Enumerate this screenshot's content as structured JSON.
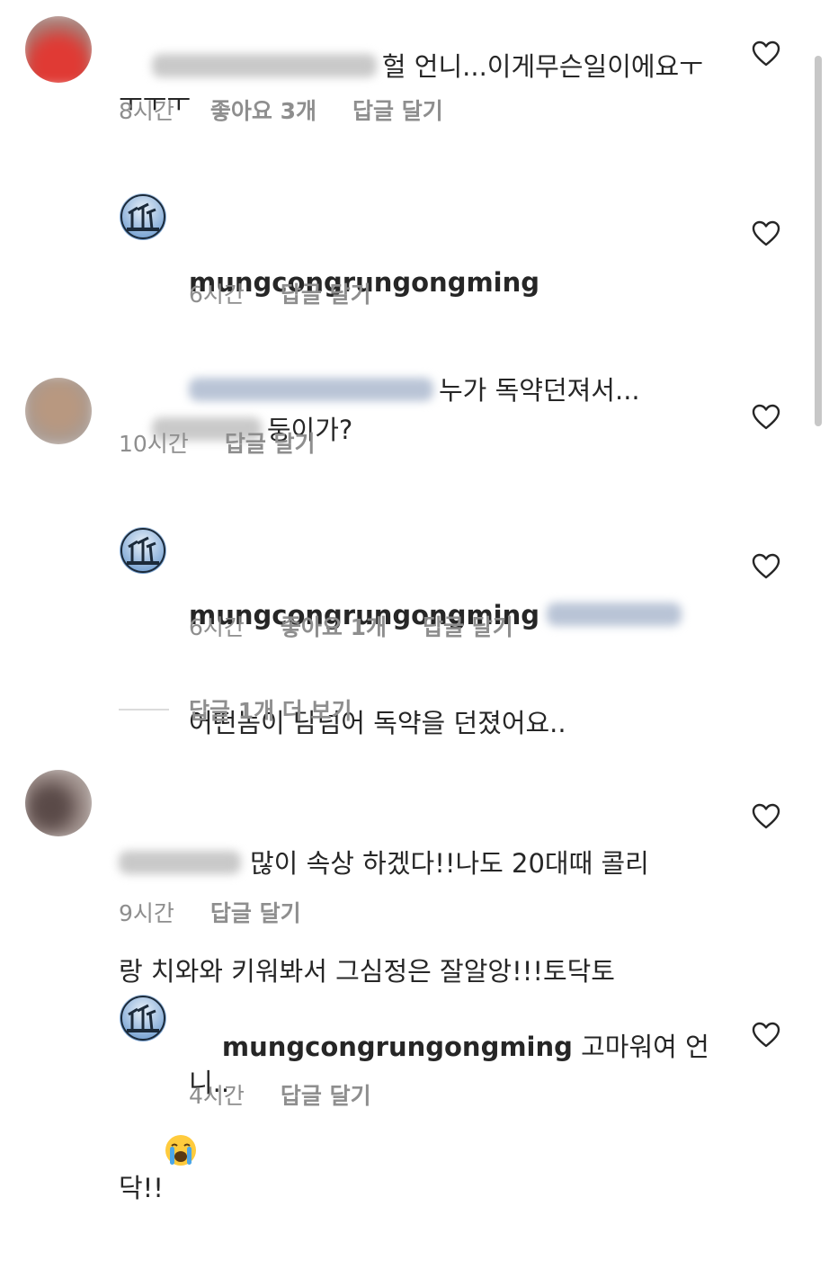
{
  "comments": [
    {
      "username": "",
      "text": "헐 언니...이게무슨일이에요ㅜ\nㅜㅜㅜ",
      "time": "8시간",
      "likes": "좋아요 3개",
      "reply": "답글 달기"
    },
    {
      "username": "mungcongrungongming",
      "text": "누가 독약던져서...",
      "time": "6시간",
      "reply": "답글 달기"
    },
    {
      "username": "",
      "text": "둥이가?",
      "time": "10시간",
      "reply": "답글 달기"
    },
    {
      "username": "mungcongrungongming",
      "text": "어떤놈이 담넘어 독약을 던졌어요..",
      "time": "6시간",
      "likes": "좋아요 1개",
      "reply": "답글 달기"
    },
    {
      "username": "",
      "text_line1": "많이 속상 하겠다!!나도 20대때 콜리",
      "text_line2": "랑 치와와 키워봐서 그심정은 잘알앙!!!토닥토",
      "text_line3": "닥!!",
      "time": "9시간",
      "reply": "답글 달기"
    },
    {
      "username": "mungcongrungongming",
      "text": "고마워여 언\n니..",
      "time": "4시간",
      "reply": "답글 달기"
    }
  ],
  "more_replies": "답글 1개 더 보기",
  "icons": {
    "like": "heart-outline-icon",
    "emoji": "loudly-crying-face"
  },
  "colors": {
    "text": "#262626",
    "meta": "#8e8e8e",
    "blur_name": "#b9c4d6"
  }
}
